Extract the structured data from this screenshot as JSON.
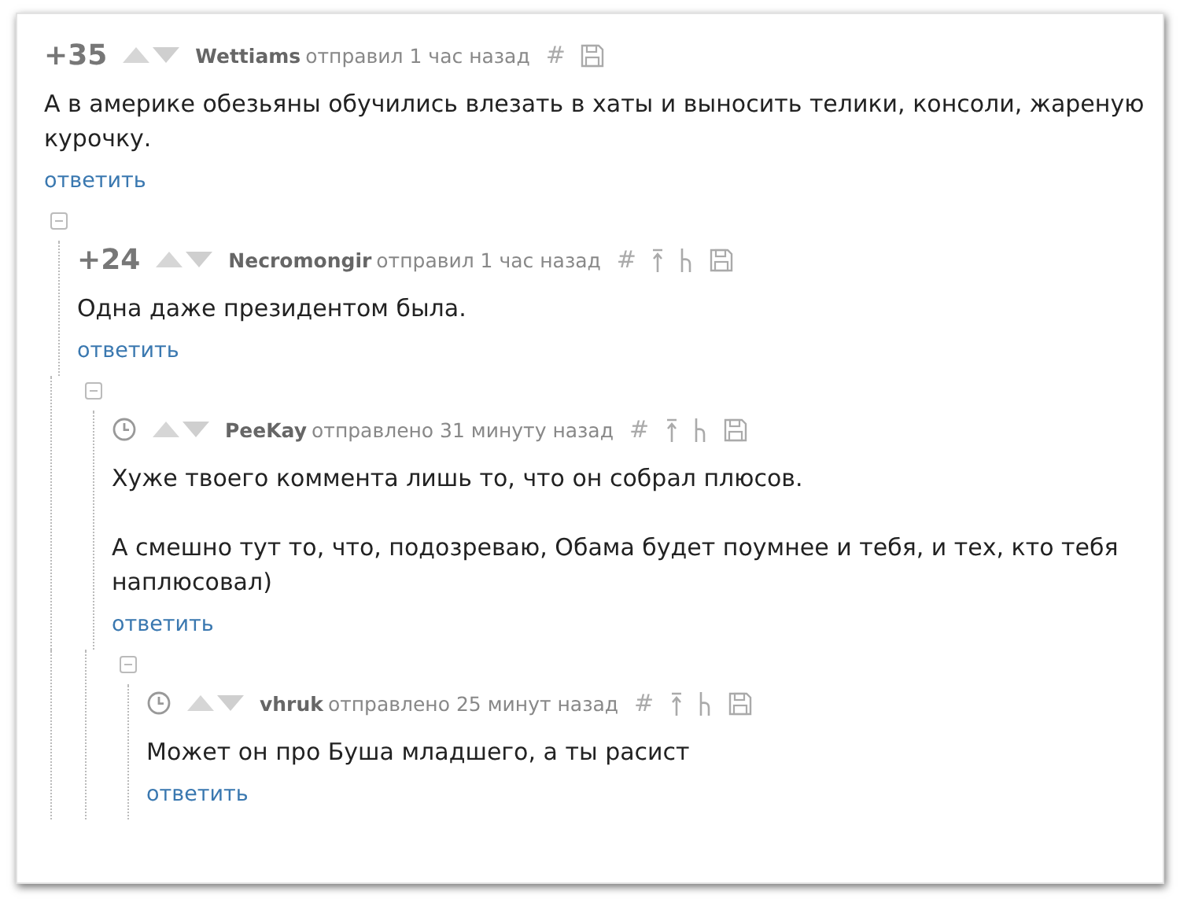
{
  "comments": [
    {
      "score": "+35",
      "author": "Wettiams",
      "meta": "отправил 1 час назад",
      "tools": [
        {
          "kind": "hash",
          "text": "#"
        },
        {
          "kind": "save"
        }
      ],
      "paragraphs": [
        "А в америке обезьяны обучились влезать в хаты и выносить телики, консоли, жареную курочку."
      ],
      "reply": "ответить",
      "children": [
        {
          "score": "+24",
          "author": "Necromongir",
          "meta": "отправил 1 час назад",
          "tools": [
            {
              "kind": "hash",
              "text": "#"
            },
            {
              "kind": "parent"
            },
            {
              "kind": "thread"
            },
            {
              "kind": "save"
            }
          ],
          "paragraphs": [
            "Одна даже президентом была."
          ],
          "reply": "ответить",
          "children": [
            {
              "author": "PeeKay",
              "meta": "отправлено 31 минуту назад",
              "tools": [
                {
                  "kind": "hash",
                  "text": "#"
                },
                {
                  "kind": "parent"
                },
                {
                  "kind": "thread"
                },
                {
                  "kind": "save"
                }
              ],
              "paragraphs": [
                "Хуже твоего коммента лишь то, что он собрал плюсов.",
                "А смешно тут то, что, подозреваю, Обама будет поумнее и тебя, и тех, кто тебя наплюсовал)"
              ],
              "reply": "ответить",
              "children": [
                {
                  "author": "vhruk",
                  "meta": "отправлено 25 минут назад",
                  "tools": [
                    {
                      "kind": "hash",
                      "text": "#"
                    },
                    {
                      "kind": "parent"
                    },
                    {
                      "kind": "thread"
                    },
                    {
                      "kind": "save"
                    }
                  ],
                  "paragraphs": [
                    "Может он про Буша младшего, а ты расист"
                  ],
                  "reply": "ответить"
                }
              ]
            }
          ]
        }
      ]
    }
  ]
}
